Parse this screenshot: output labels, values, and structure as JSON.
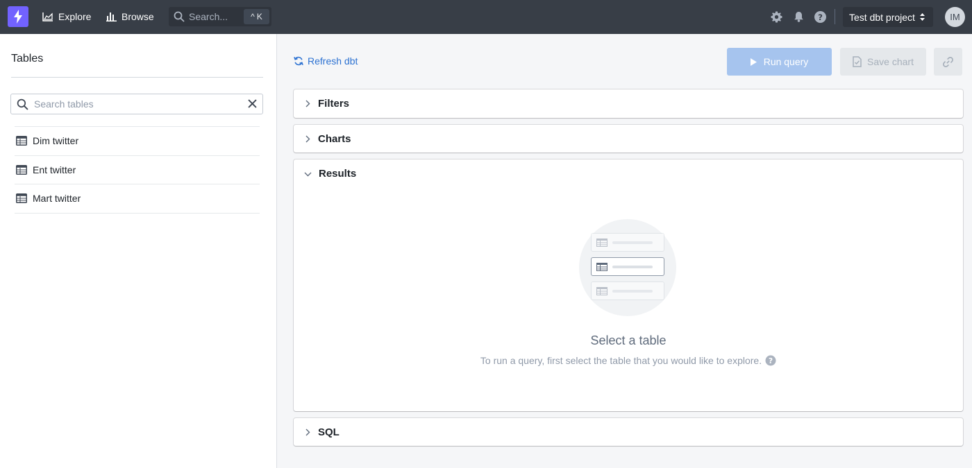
{
  "nav": {
    "explore_label": "Explore",
    "browse_label": "Browse",
    "search_placeholder": "Search...",
    "search_shortcut": "K",
    "project_name": "Test dbt project",
    "avatar_initials": "IM"
  },
  "sidebar": {
    "title": "Tables",
    "search_placeholder": "Search tables",
    "tables": [
      {
        "label": "Dim twitter"
      },
      {
        "label": "Ent twitter"
      },
      {
        "label": "Mart twitter"
      }
    ]
  },
  "toolbar": {
    "refresh_label": "Refresh dbt",
    "run_label": "Run query",
    "save_label": "Save chart"
  },
  "sections": {
    "filters": "Filters",
    "charts": "Charts",
    "results": "Results",
    "sql": "SQL"
  },
  "results_empty": {
    "title": "Select a table",
    "description": "To run a query, first select the table that you would like to explore."
  },
  "colors": {
    "topbar": "#383e47",
    "brand": "#7262ff",
    "link": "#2d72d2",
    "run_disabled": "#a6c4ee"
  }
}
